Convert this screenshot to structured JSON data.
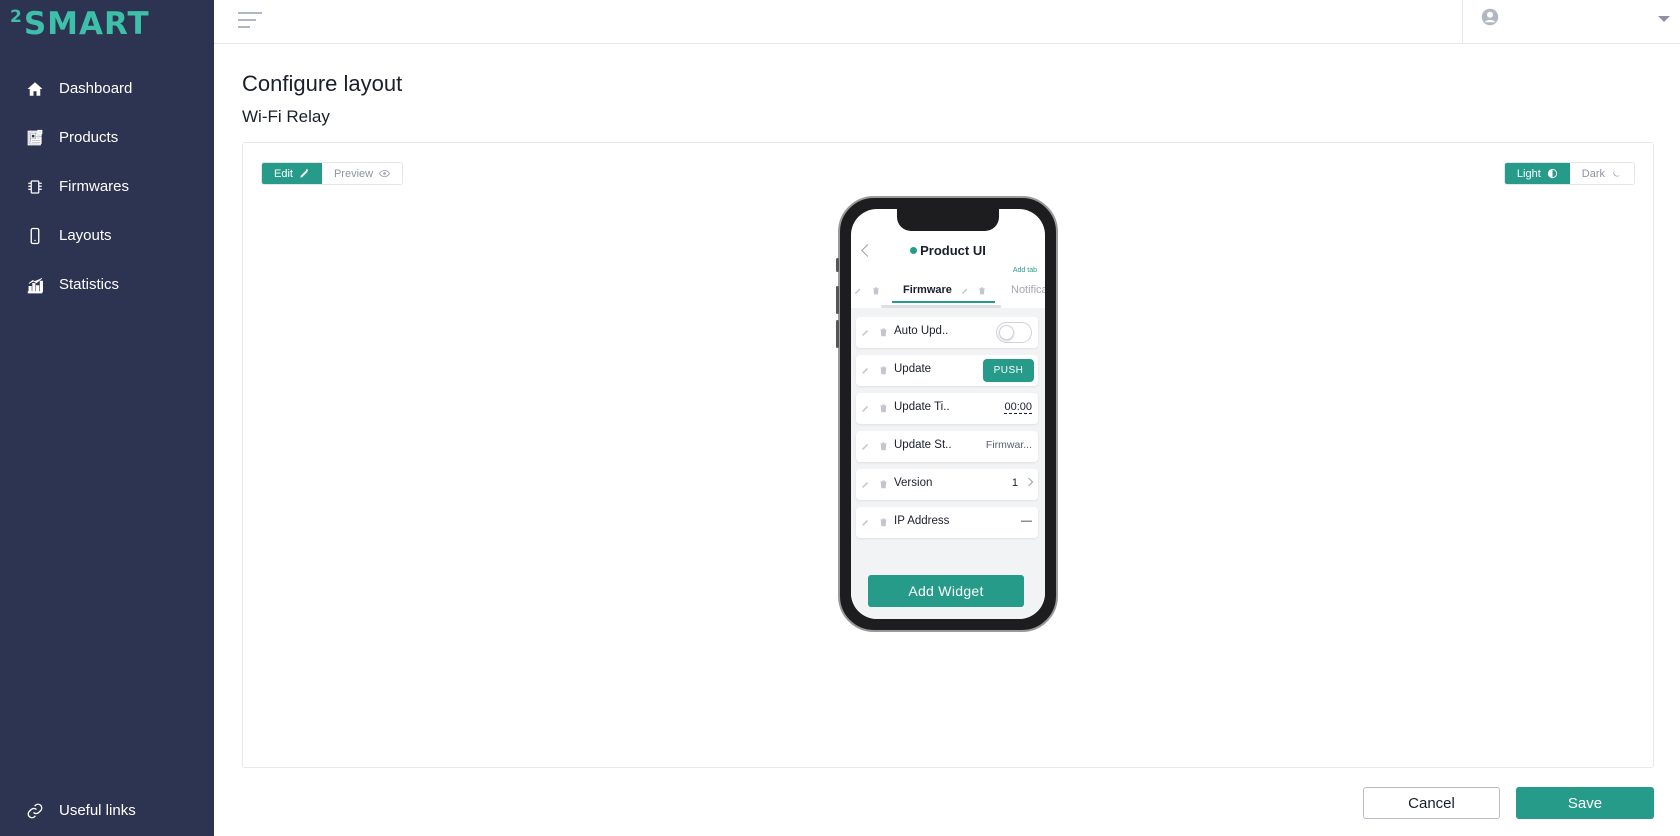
{
  "brand": {
    "logo_sup": "2",
    "logo_text": "SMART",
    "accent": "#279b8a",
    "sidebar_bg": "#2d3451"
  },
  "sidebar": {
    "items": [
      {
        "label": "Dashboard",
        "icon": "home-icon"
      },
      {
        "label": "Products",
        "icon": "products-icon"
      },
      {
        "label": "Firmwares",
        "icon": "chip-icon"
      },
      {
        "label": "Layouts",
        "icon": "smartphone-icon"
      },
      {
        "label": "Statistics",
        "icon": "bar-chart-icon"
      }
    ],
    "bottom": {
      "label": "Useful links",
      "icon": "link-icon"
    }
  },
  "header": {
    "title": "Configure layout",
    "subtitle": "Wi-Fi Relay"
  },
  "mode_toggle": {
    "edit": "Edit",
    "preview": "Preview",
    "active": "edit"
  },
  "theme_toggle": {
    "light": "Light",
    "dark": "Dark",
    "active": "light"
  },
  "phone": {
    "title": "Product UI",
    "add_tab": "Add tab",
    "tabs": [
      {
        "label": "Firmware",
        "active": true
      },
      {
        "label": "Notifica",
        "active": false
      }
    ],
    "widgets": [
      {
        "label": "Auto Upd..",
        "type": "toggle",
        "value": "off"
      },
      {
        "label": "Update",
        "type": "button",
        "value": "PUSH"
      },
      {
        "label": "Update Ti..",
        "type": "time",
        "value": "00:00"
      },
      {
        "label": "Update St..",
        "type": "text",
        "value": "Firmwar..."
      },
      {
        "label": "Version",
        "type": "link",
        "value": "1"
      },
      {
        "label": "IP Address",
        "type": "text",
        "value": "—"
      }
    ],
    "add_widget": "Add Widget"
  },
  "footer": {
    "cancel": "Cancel",
    "save": "Save"
  }
}
